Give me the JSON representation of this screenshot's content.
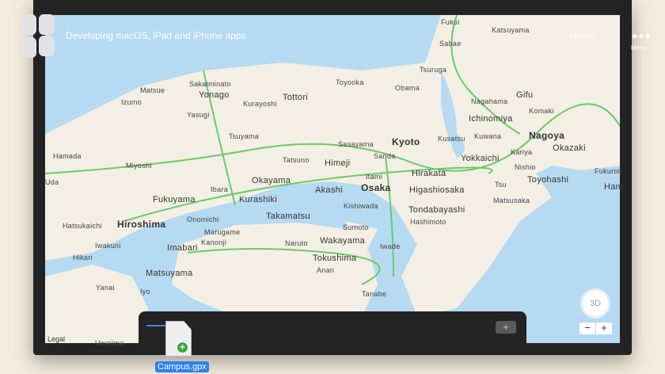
{
  "header": {
    "title": "Developing macOS, iPad and iPhone apps",
    "home": "Home",
    "menu_label": "Menu",
    "menu_icon": "ellipsis-icon"
  },
  "map": {
    "cities": [
      "Fukui",
      "Katsuyama",
      "Sabae",
      "Tsuruga",
      "Matsue",
      "Sakaiminato",
      "Yonago",
      "Toyooka",
      "Obama",
      "Izumo",
      "Kurayoshi",
      "Tottori",
      "Yasugi",
      "Nagahama",
      "Gifu",
      "Komaki",
      "Ichinomiya",
      "Nagoya",
      "Kuwana",
      "Kariya",
      "Okazaki",
      "Kyoto",
      "Kusatsu",
      "Yokkaichi",
      "Tsuyama",
      "Sasayama",
      "Sanda",
      "Tatsuno",
      "Himeji",
      "Hamada",
      "Miyoshi",
      "Itami",
      "Hirakata",
      "Osaka",
      "Higashiosaka",
      "Akashi",
      "Okayama",
      "Ibara",
      "Kurashiki",
      "Fukuyama",
      "Onomichi",
      "Hiroshima",
      "Hatsukaichi",
      "Takamatsu",
      "Marugame",
      "Kanonji",
      "Imabari",
      "Iwakuni",
      "Naruto",
      "Wakayama",
      "Sumoto",
      "Iwade",
      "Hashimoto",
      "Tondabayashi",
      "Kishiwada",
      "Tokushima",
      "Anan",
      "Tanabe",
      "Tsu",
      "Matsusaka",
      "Nishio",
      "Toyohashi",
      "Fukuroi",
      "Ham",
      "Hikari",
      "Yanai",
      "Matsuyama",
      "Iyo",
      "Uwajima",
      "Uda"
    ],
    "legal": "Legal",
    "compass": "3D",
    "zoom_out": "−",
    "zoom_in": "+",
    "colors": {
      "water": "#b5daf1",
      "land": "#f3efe4",
      "highway": "#6cc86c",
      "border": "#e7b7a9"
    }
  },
  "tray": {
    "add": "+",
    "file_name": "Campus.gpx"
  }
}
